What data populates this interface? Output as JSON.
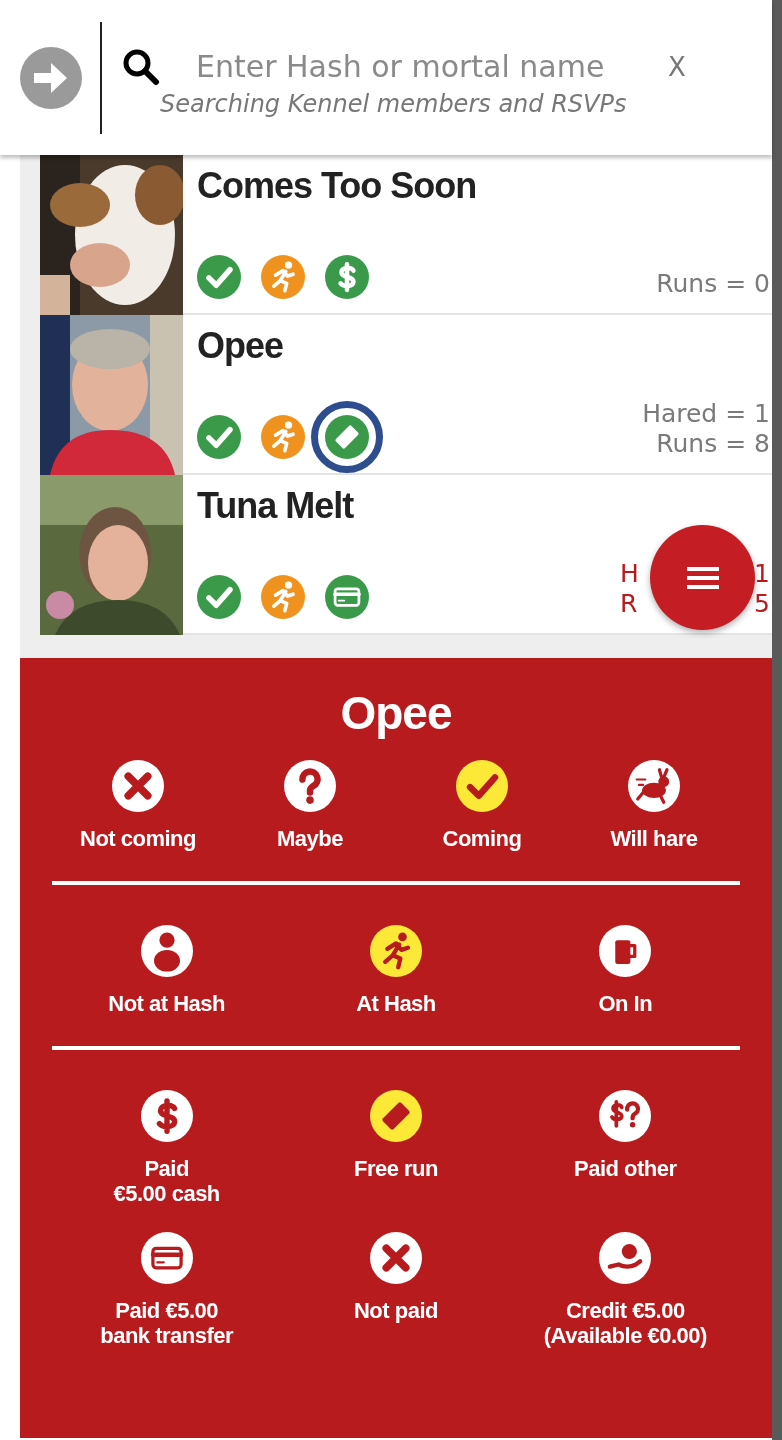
{
  "header": {
    "search": {
      "placeholder": "Enter Hash or mortal name"
    },
    "clear": "X",
    "hint": "Searching Kennel members and RSVPs"
  },
  "members": [
    {
      "name": "Comes Too Soon",
      "alert": false,
      "statuses": [
        {
          "kind": "check",
          "highlighted": false
        },
        {
          "kind": "runner",
          "highlighted": false
        },
        {
          "kind": "dollar",
          "highlighted": false
        }
      ],
      "stats": [
        [
          "Runs = 0"
        ]
      ]
    },
    {
      "name": "Opee",
      "alert": false,
      "statuses": [
        {
          "kind": "check",
          "highlighted": false
        },
        {
          "kind": "runner",
          "highlighted": false
        },
        {
          "kind": "free",
          "highlighted": true
        }
      ],
      "stats": [
        [
          "Hared = 1"
        ],
        [
          "Runs = 8"
        ]
      ]
    },
    {
      "name": "Tuna Melt",
      "alert": true,
      "statuses": [
        {
          "kind": "check",
          "highlighted": false
        },
        {
          "kind": "runner",
          "highlighted": false
        },
        {
          "kind": "card",
          "highlighted": false
        }
      ],
      "stats": [
        [
          "H",
          "1"
        ],
        [
          "R",
          "5"
        ]
      ]
    }
  ],
  "panel": {
    "title": "Opee",
    "groups": [
      [
        {
          "label": "Not coming",
          "kind": "cross",
          "selected": false
        },
        {
          "label": "Maybe",
          "kind": "question",
          "selected": false
        },
        {
          "label": "Coming",
          "kind": "check",
          "selected": true
        },
        {
          "label": "Will hare",
          "kind": "hare",
          "selected": false
        }
      ],
      [
        {
          "label": "Not at Hash",
          "kind": "person",
          "selected": false
        },
        {
          "label": "At Hash",
          "kind": "runner",
          "selected": true
        },
        {
          "label": "On In",
          "kind": "beer",
          "selected": false
        }
      ],
      [
        {
          "label": "Paid\n€5.00 cash",
          "kind": "dollar",
          "selected": false
        },
        {
          "label": "Free run",
          "kind": "free",
          "selected": true
        },
        {
          "label": "Paid other",
          "kind": "dollar-question",
          "selected": false
        },
        {
          "label": "Paid €5.00\nbank transfer",
          "kind": "card",
          "selected": false
        },
        {
          "label": "Not paid",
          "kind": "cross",
          "selected": false
        },
        {
          "label": "Credit €5.00\n(Available €0.00)",
          "kind": "credit",
          "selected": false
        }
      ]
    ]
  }
}
